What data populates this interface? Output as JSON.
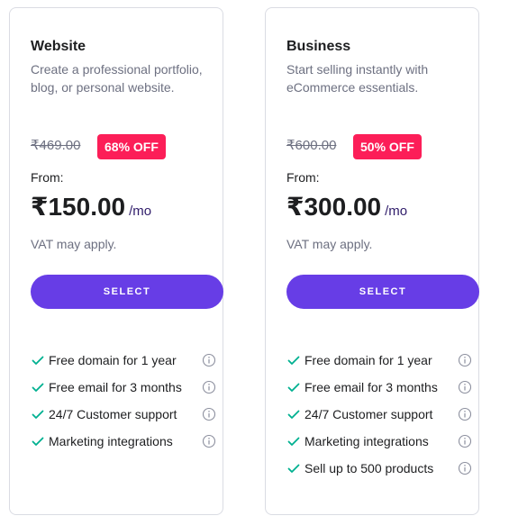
{
  "plans": [
    {
      "name": "Website",
      "description": "Create a professional portfolio, blog, or personal website.",
      "original_price": "₹469.00",
      "discount": "68% OFF",
      "from_label": "From:",
      "price": "₹150.00",
      "period": "/mo",
      "vat_note": "VAT may apply.",
      "button_label": "SELECT",
      "features": [
        "Free domain for 1 year",
        "Free email for 3 months",
        "24/7 Customer support",
        "Marketing integrations"
      ]
    },
    {
      "name": "Business",
      "description": "Start selling instantly with eCommerce essentials.",
      "original_price": "₹600.00",
      "discount": "50% OFF",
      "from_label": "From:",
      "price": "₹300.00",
      "period": "/mo",
      "vat_note": "VAT may apply.",
      "button_label": "SELECT",
      "features": [
        "Free domain for 1 year",
        "Free email for 3 months",
        "24/7 Customer support",
        "Marketing integrations",
        "Sell up to 500 products"
      ]
    }
  ],
  "icons": {
    "check": "check-icon",
    "info": "info-icon"
  },
  "colors": {
    "accent": "#673de6",
    "badge": "#fc1e58",
    "check": "#00b090",
    "muted_text": "#6d7081",
    "text": "#1d1e20"
  }
}
